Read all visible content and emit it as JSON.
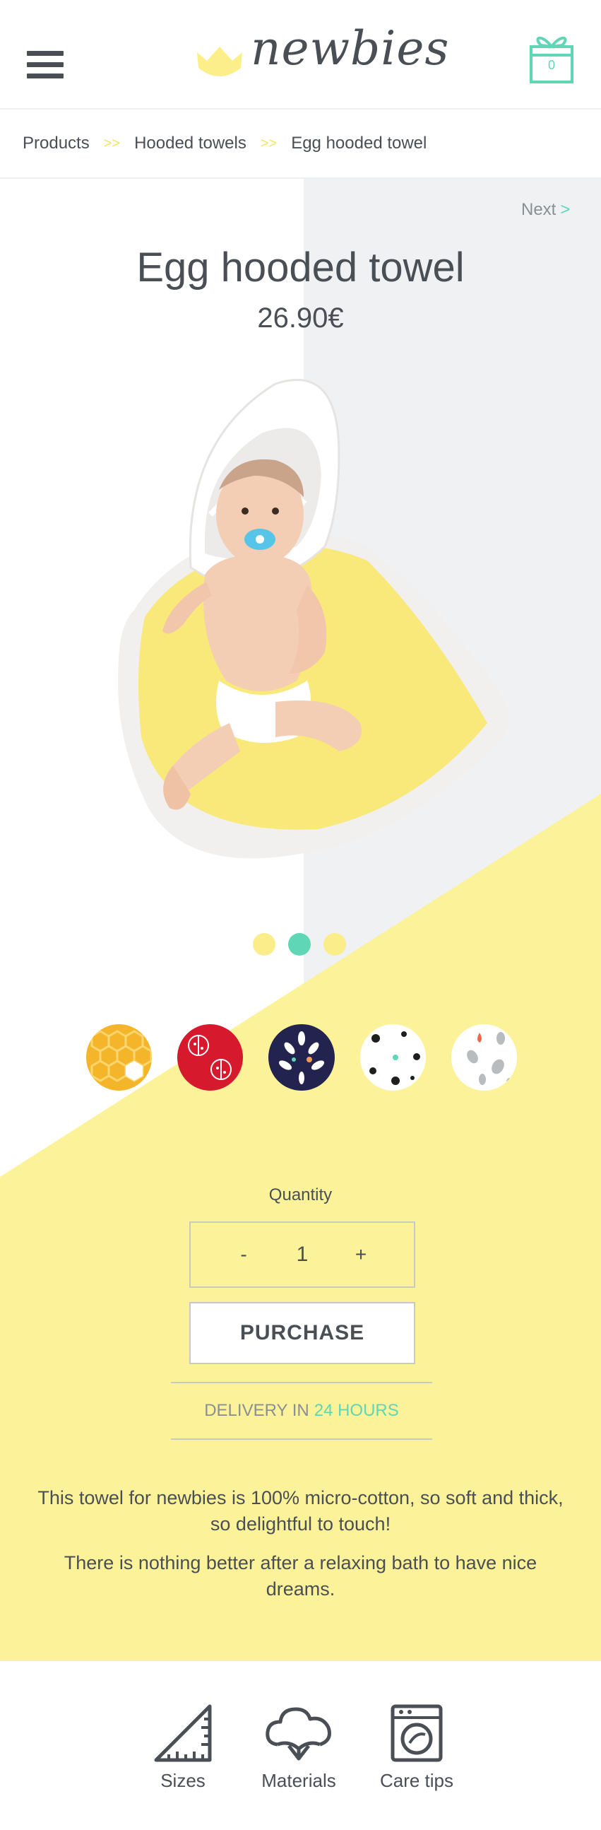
{
  "header": {
    "logo_text": "newbies",
    "cart_count": "0"
  },
  "breadcrumb": {
    "items": [
      "Products",
      "Hooded towels",
      "Egg hooded towel"
    ],
    "separator": ">>"
  },
  "product": {
    "next_label": "Next",
    "next_arrow": ">",
    "title": "Egg hooded towel",
    "price": "26.90€"
  },
  "carousel": {
    "dots": 3,
    "active_index": 1
  },
  "swatches": [
    {
      "name": "yellow-honeycomb",
      "color": "#f5b52a"
    },
    {
      "name": "red-ladybug",
      "color": "#d6192c"
    },
    {
      "name": "navy-leaves",
      "color": "#23234f"
    },
    {
      "name": "white-black-dots",
      "color": "#ffffff"
    },
    {
      "name": "white-grey-drops",
      "color": "#ffffff"
    }
  ],
  "purchase": {
    "quantity_label": "Quantity",
    "minus": "-",
    "plus": "+",
    "quantity_value": "1",
    "button_label": "PURCHASE",
    "delivery_prefix": "DELIVERY IN",
    "delivery_highlight": "24 HOURS"
  },
  "description": [
    "This towel for newbies is 100% micro-cotton, so soft and thick, so delightful to touch!",
    "There is nothing better after a relaxing bath to have nice dreams."
  ],
  "footer_links": [
    {
      "label": "Sizes",
      "icon": "ruler-icon"
    },
    {
      "label": "Materials",
      "icon": "cotton-icon"
    },
    {
      "label": "Care tips",
      "icon": "washing-machine-icon"
    }
  ],
  "colors": {
    "accent_yellow": "#fcf29a",
    "accent_mint": "#5fd6b5",
    "text_dark": "#4a4f55",
    "hero_gray": "#eff1f3"
  }
}
